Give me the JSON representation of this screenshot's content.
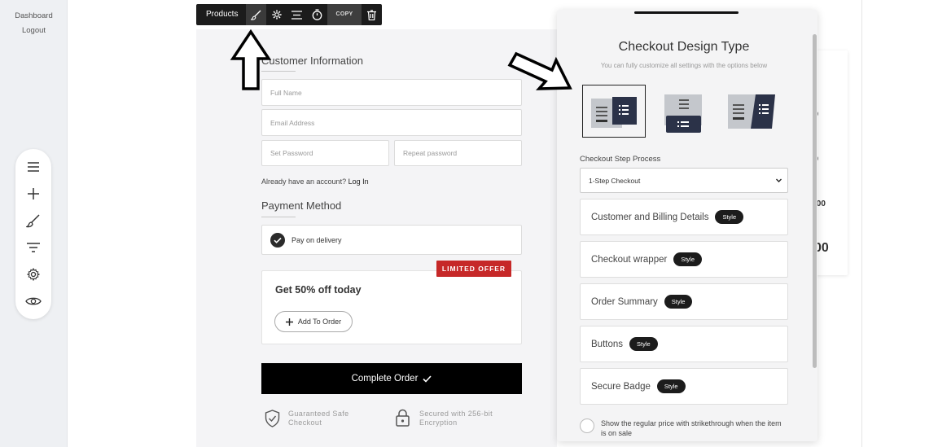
{
  "admin": {
    "links": [
      "Dashboard",
      "Logout"
    ]
  },
  "vertical_toolbar": {
    "icons": [
      "menu-icon",
      "plus-icon",
      "brush-icon",
      "filter-icon",
      "gear-icon",
      "eye-icon"
    ]
  },
  "editor_toolbar": {
    "label": "Products",
    "icons": [
      "brush-icon",
      "gear-icon",
      "align-icon",
      "timer-icon"
    ],
    "copy_label": "COPY",
    "delete_icon": "trash-icon"
  },
  "checkout_form": {
    "customer_title": "Customer Information",
    "full_name_placeholder": "Full Name",
    "email_placeholder": "Email Address",
    "password_placeholder": "Set Password",
    "repeat_placeholder": "Repeat password",
    "account_text": "Already have an account?",
    "login_link": "Log In",
    "payment_title": "Payment Method",
    "payment_option": "Pay on delivery",
    "offer_badge": "LIMITED OFFER",
    "offer_title": "Get 50% off today",
    "add_to_order": "Add To Order",
    "complete_order": "Complete Order",
    "trust": [
      {
        "line1": "Guaranteed Safe",
        "line2": "Checkout",
        "icon": "shield-check-icon"
      },
      {
        "line1": "Secured with 256-bit",
        "line2": "Encryption",
        "icon": "lock-icon"
      }
    ]
  },
  "side_card": {
    "values": [
      "0",
      "0",
      ".00",
      "00"
    ]
  },
  "panel": {
    "title": "Checkout Design Type",
    "subtitle": "You can fully customize all settings with the options below",
    "step_label": "Checkout Step Process",
    "step_value": "1-Step Checkout",
    "rows": [
      {
        "label": "Customer and Billing Details",
        "pill": "Style"
      },
      {
        "label": "Checkout wrapper",
        "pill": "Style"
      },
      {
        "label": "Order Summary",
        "pill": "Style"
      },
      {
        "label": "Buttons",
        "pill": "Style"
      },
      {
        "label": "Secure Badge",
        "pill": "Style"
      }
    ],
    "strike_option": "Show the regular price with strikethrough when the item is on sale"
  },
  "colors": {
    "accent_dark": "#1c1c1c",
    "offer_red": "#c62828",
    "panel_bg": "#f4f4f5",
    "design_navy": "#2b3248"
  }
}
